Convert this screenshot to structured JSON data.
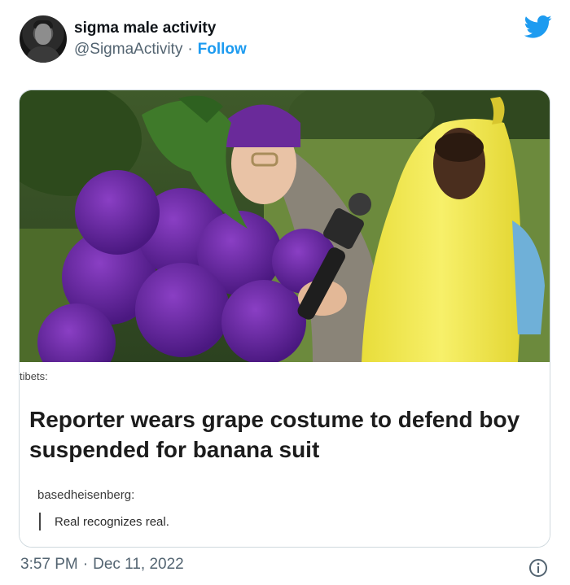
{
  "author": {
    "name": "sigma male activity",
    "handle": "@SigmaActivity",
    "separator": "·",
    "follow_label": "Follow"
  },
  "platform_icon": "twitter-bird-icon",
  "colors": {
    "brand_blue": "#1d9bf0",
    "secondary_text": "#536471",
    "border": "#cfd9de"
  },
  "meme": {
    "username_top": "tibets:",
    "headline": "Reporter wears grape costume to defend boy suspended for banana suit",
    "reply_username": "basedheisenberg:",
    "reply_text": "Real recognizes real."
  },
  "footer": {
    "time": "3:57 PM",
    "separator": "·",
    "date": "Dec 11, 2022",
    "info_icon": "info-circle-icon"
  }
}
